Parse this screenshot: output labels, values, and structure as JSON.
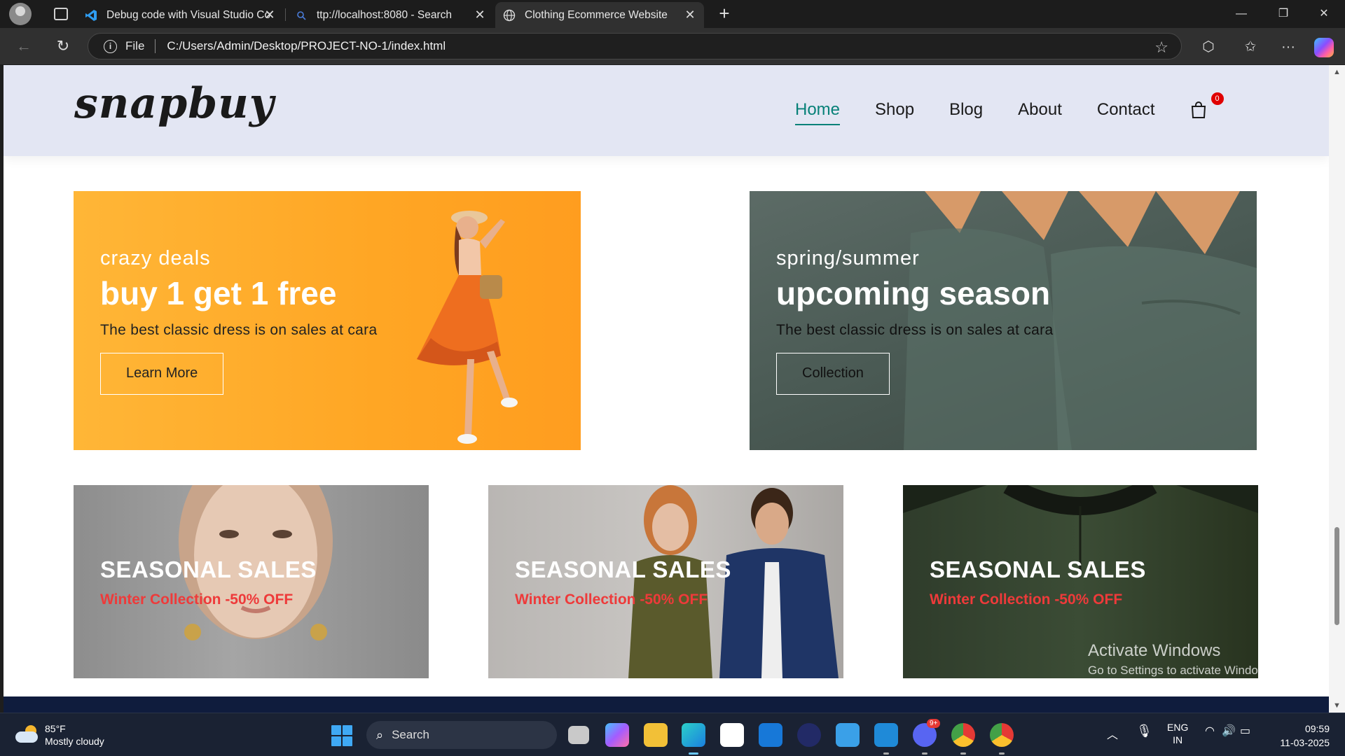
{
  "browser": {
    "tabs": [
      {
        "title": "Debug code with Visual Studio Co",
        "icon": "vscode-icon"
      },
      {
        "title": "ttp://localhost:8080 - Search",
        "icon": "search-icon"
      },
      {
        "title": "Clothing Ecommerce Website",
        "icon": "globe-icon",
        "active": true
      }
    ],
    "address": {
      "scheme_label": "File",
      "url": "C:/Users/Admin/Desktop/PROJECT-NO-1/index.html"
    }
  },
  "site": {
    "logo": "snapbuy",
    "nav": [
      {
        "label": "Home",
        "active": true
      },
      {
        "label": "Shop"
      },
      {
        "label": "Blog"
      },
      {
        "label": "About"
      },
      {
        "label": "Contact"
      }
    ],
    "cart_count": "0",
    "banners": [
      {
        "small": "crazy deals",
        "big": "buy 1 get 1 free",
        "desc": "The best classic dress is on sales at cara",
        "button": "Learn More"
      },
      {
        "small": "spring/summer",
        "big": "upcoming season",
        "desc": "The best classic dress is on sales at cara",
        "button": "Collection"
      }
    ],
    "seasonal": [
      {
        "title": "SEASONAL SALES",
        "sub": "Winter Collection -50% OFF"
      },
      {
        "title": "SEASONAL SALES",
        "sub": "Winter Collection -50% OFF"
      },
      {
        "title": "SEASONAL SALES",
        "sub": "Winter Collection -50% OFF"
      }
    ],
    "colors": {
      "accent": "#088178",
      "header_bg": "#e3e6f3",
      "sale_red": "#ee3a3a",
      "banner1_bg": "#ffa624"
    }
  },
  "watermark": {
    "line1": "Activate Windows",
    "line2": "Go to Settings to activate Windows."
  },
  "taskbar": {
    "weather_temp": "85°F",
    "weather_desc": "Mostly cloudy",
    "search_label": "Search",
    "notif_badge": "9+",
    "lang_top": "ENG",
    "lang_bottom": "IN",
    "time": "09:59",
    "date": "11-03-2025"
  }
}
